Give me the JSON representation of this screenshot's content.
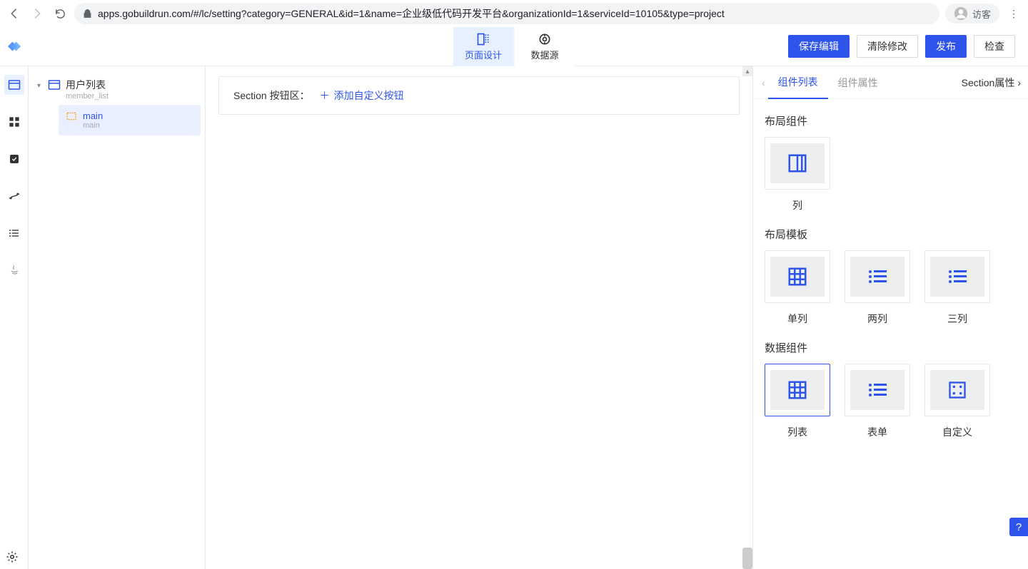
{
  "browser": {
    "url": "apps.gobuildrun.com/#/lc/setting?category=GENERAL&id=1&name=企业级低代码开发平台&organizationId=1&serviceId=10105&type=project",
    "guest_label": "访客"
  },
  "header": {
    "tabs": {
      "design": "页面设计",
      "datasource": "数据源"
    },
    "actions": {
      "save": "保存编辑",
      "clear": "清除修改",
      "publish": "发布",
      "inspect": "检查"
    }
  },
  "tree": {
    "root": {
      "title": "用户列表",
      "sub": "member_list"
    },
    "child": {
      "title": "main",
      "sub": "main"
    }
  },
  "canvas": {
    "section_label": "Section 按钮区：",
    "add_label": "添加自定义按钮"
  },
  "right": {
    "tab_components": "组件列表",
    "tab_props": "组件属性",
    "section_props": "Section属性",
    "group_layout": "布局组件",
    "group_template": "布局模板",
    "group_data": "数据组件",
    "comp_col": "列",
    "comp_single": "单列",
    "comp_double": "两列",
    "comp_triple": "三列",
    "comp_list": "列表",
    "comp_form": "表单",
    "comp_custom": "自定义"
  }
}
